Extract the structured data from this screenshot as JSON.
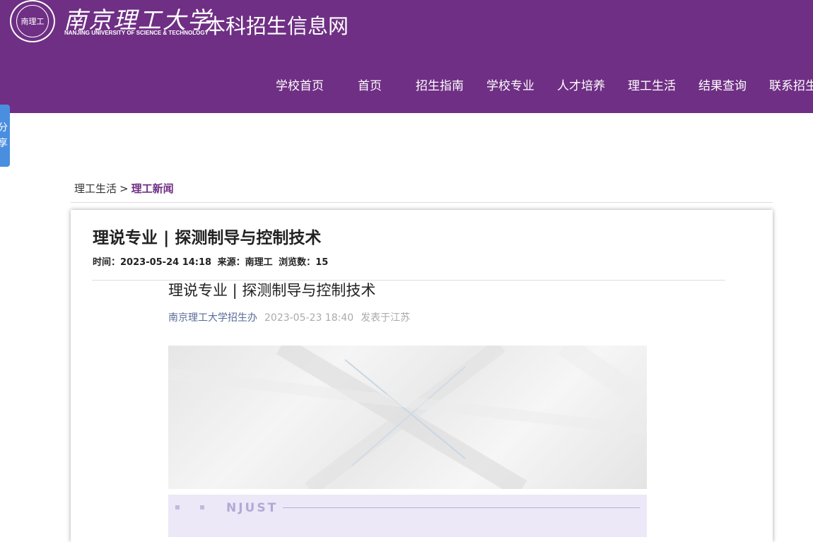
{
  "header": {
    "logo_seal_text": "南理工",
    "logo_cn": "南京理工大学",
    "logo_en": "NANJING UNIVERSITY OF SCIENCE & TECHNOLOGY",
    "site_name": "本科招生信息网",
    "bg_color": "#6f2f84"
  },
  "nav": [
    "学校首页",
    "首页",
    "招生指南",
    "学校专业",
    "人才培养",
    "理工生活",
    "结果查询",
    "联系招生"
  ],
  "share": {
    "line1": "分",
    "line2": "享"
  },
  "breadcrumb": {
    "parent": "理工生活",
    "separator": ">",
    "current": "理工新闻"
  },
  "article": {
    "title": "理说专业 | 探测制导与控制技术",
    "time_label": "时间：",
    "time": "2023-05-24 14:18",
    "source_label": "来源：",
    "source": "南理工",
    "views_label": "浏览数：",
    "views": "15"
  },
  "wechat": {
    "title": "理说专业 | 探测制导与控制技术",
    "author": "南京理工大学招生办",
    "date": "2023-05-23 18:40",
    "location": "发表于江苏",
    "strip_label": "NJUST"
  }
}
